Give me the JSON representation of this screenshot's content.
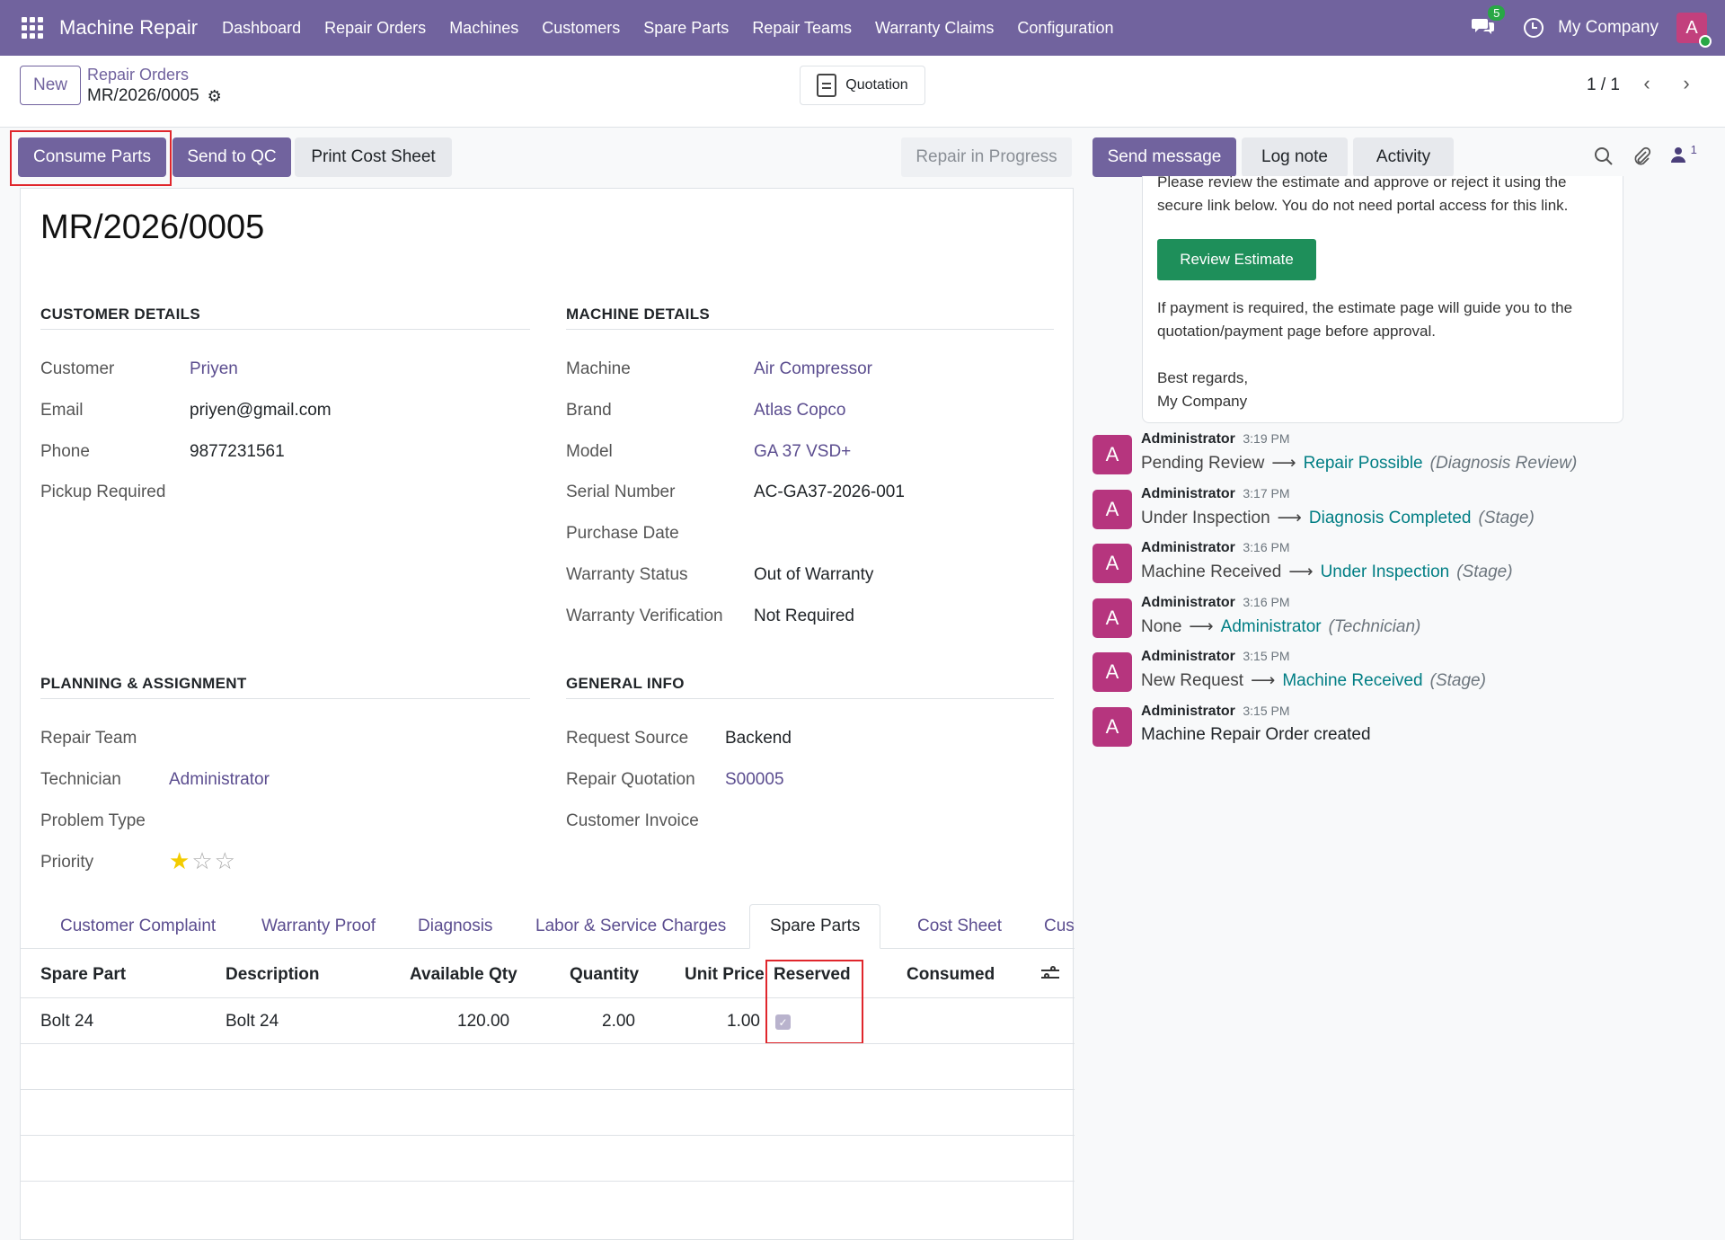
{
  "navbar": {
    "app_name": "Machine Repair",
    "menu": [
      "Dashboard",
      "Repair Orders",
      "Machines",
      "Customers",
      "Spare Parts",
      "Repair Teams",
      "Warranty Claims",
      "Configuration"
    ],
    "chat_count": "5",
    "company": "My Company",
    "avatar_letter": "A"
  },
  "control": {
    "new_label": "New",
    "breadcrumb_parent": "Repair Orders",
    "breadcrumb_current": "MR/2026/0005",
    "quotation_label": "Quotation",
    "pager": "1 / 1"
  },
  "statusbar": {
    "consume_parts": "Consume Parts",
    "send_to_qc": "Send to QC",
    "print_cost_sheet": "Print Cost Sheet",
    "stage": "Repair in Progress"
  },
  "form": {
    "title": "MR/2026/0005",
    "customer_details": {
      "heading": "CUSTOMER DETAILS",
      "customer_label": "Customer",
      "customer": "Priyen",
      "email_label": "Email",
      "email": "priyen@gmail.com",
      "phone_label": "Phone",
      "phone": "9877231561",
      "pickup_label": "Pickup Required"
    },
    "machine_details": {
      "heading": "MACHINE DETAILS",
      "machine_label": "Machine",
      "machine": "Air Compressor",
      "brand_label": "Brand",
      "brand": "Atlas Copco",
      "model_label": "Model",
      "model": "GA 37 VSD+",
      "serial_label": "Serial Number",
      "serial": "AC-GA37-2026-001",
      "purchase_label": "Purchase Date",
      "warranty_status_label": "Warranty Status",
      "warranty_status": "Out of Warranty",
      "warranty_verif_label": "Warranty Verification",
      "warranty_verif": "Not Required"
    },
    "planning": {
      "heading": "PLANNING & ASSIGNMENT",
      "team_label": "Repair Team",
      "tech_label": "Technician",
      "technician": "Administrator",
      "problem_label": "Problem Type",
      "priority_label": "Priority",
      "priority_stars": 1,
      "priority_max": 3
    },
    "general": {
      "heading": "GENERAL INFO",
      "source_label": "Request Source",
      "source": "Backend",
      "quotation_label": "Repair Quotation",
      "quotation": "S00005",
      "invoice_label": "Customer Invoice"
    },
    "tabs": [
      "Customer Complaint",
      "Warranty Proof",
      "Diagnosis",
      "Labor & Service Charges",
      "Spare Parts",
      "Cost Sheet",
      "Custo"
    ],
    "active_tab": "Spare Parts",
    "table": {
      "headers": [
        "Spare Part",
        "Description",
        "Available Qty",
        "Quantity",
        "Unit Price",
        "Reserved",
        "Consumed"
      ],
      "rows": [
        {
          "part": "Bolt 24",
          "description": "Bolt 24",
          "available": "120.00",
          "quantity": "2.00",
          "unit_price": "1.00",
          "reserved": true,
          "consumed": ""
        }
      ]
    }
  },
  "chatter": {
    "send_message": "Send message",
    "log_note": "Log note",
    "activity": "Activity",
    "followers": "1",
    "mail_line1": "Please review the estimate and approve or reject it using the",
    "mail_line2": "secure link below. You do not need portal access for this link.",
    "review_button": "Review Estimate",
    "mail_line3": "If payment is required, the estimate page will guide you to the",
    "mail_line4": "quotation/payment page before approval.",
    "mail_line5": "Best regards,",
    "mail_line6": "My Company",
    "messages": [
      {
        "author": "Administrator",
        "time": "3:19 PM",
        "old": "Pending Review",
        "new": "Repair Possible",
        "field": "(Diagnosis Review)"
      },
      {
        "author": "Administrator",
        "time": "3:17 PM",
        "old": "Under Inspection",
        "new": "Diagnosis Completed",
        "field": "(Stage)"
      },
      {
        "author": "Administrator",
        "time": "3:16 PM",
        "old": "Machine Received",
        "new": "Under Inspection",
        "field": "(Stage)"
      },
      {
        "author": "Administrator",
        "time": "3:16 PM",
        "old": "None",
        "new": "Administrator",
        "field": "(Technician)"
      },
      {
        "author": "Administrator",
        "time": "3:15 PM",
        "old": "New Request",
        "new": "Machine Received",
        "field": "(Stage)"
      },
      {
        "author": "Administrator",
        "time": "3:15 PM",
        "text": "Machine Repair Order created"
      }
    ]
  },
  "colors": {
    "brand": "#71639e",
    "highlight": "#e0262c",
    "review_button": "#1e8f5a",
    "value_link": "#017e84"
  }
}
